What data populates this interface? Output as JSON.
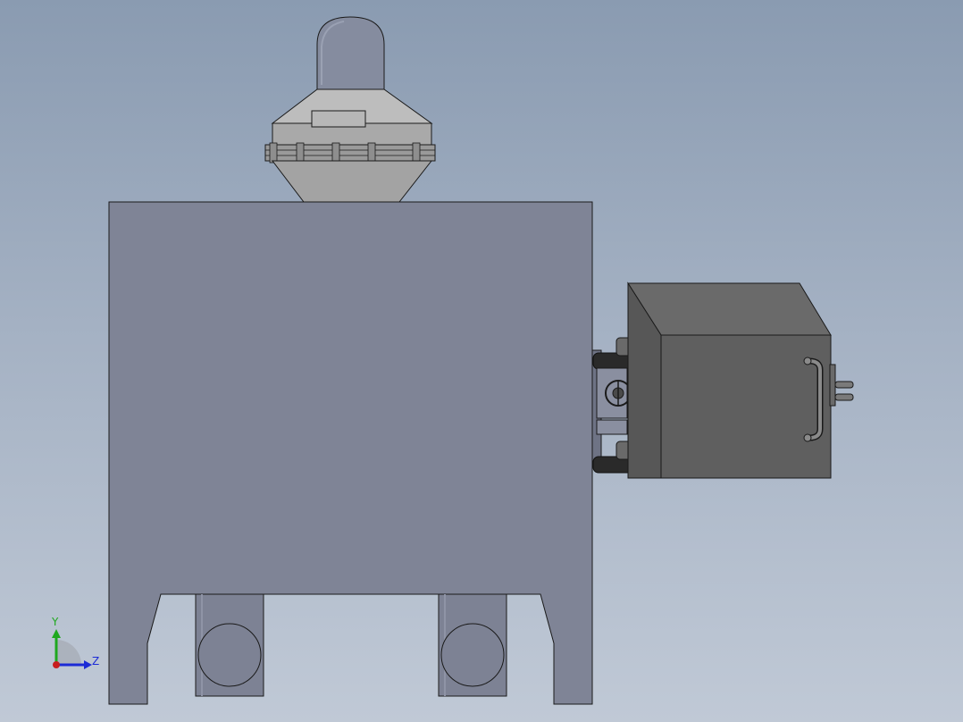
{
  "viewport": {
    "background_top": "#8a9bb1",
    "background_bottom": "#c0c9d6"
  },
  "model": {
    "body_color": "#7f8496",
    "motor_color": "#5f5f5f",
    "cap_color": "#858c9f",
    "hopper_color": "#a9a9a9",
    "outline_color": "#1a1a1a"
  },
  "triad": {
    "y_label": "Y",
    "z_label": "Z",
    "y_color": "#1fa81f",
    "z_color": "#1c2bd6",
    "x_color": "#c81e1e"
  }
}
